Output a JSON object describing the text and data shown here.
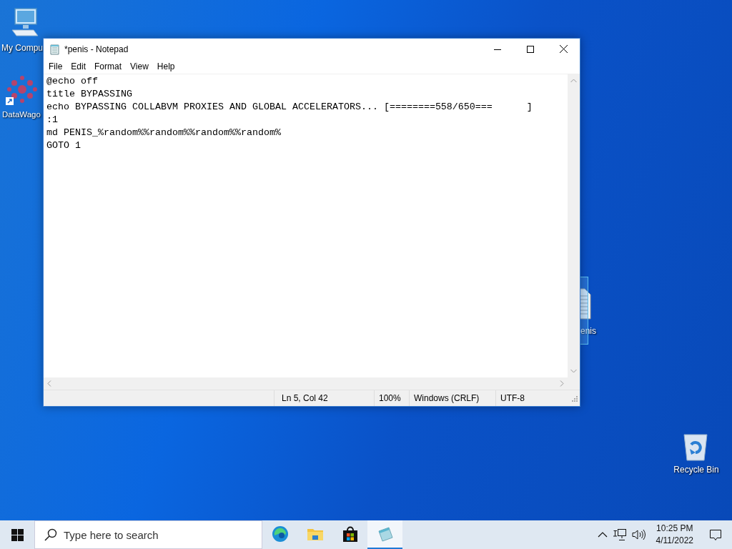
{
  "desktop": {
    "icons": [
      {
        "kind": "computer",
        "label": "My Compu",
        "selected": false
      },
      {
        "kind": "cluster",
        "label": "DataWago",
        "selected": false
      },
      {
        "kind": "document",
        "label": "enis",
        "selected": true
      },
      {
        "kind": "recycle",
        "label": "Recycle Bin",
        "selected": false
      }
    ]
  },
  "window": {
    "title": "*penis - Notepad",
    "menu": [
      "File",
      "Edit",
      "Format",
      "View",
      "Help"
    ],
    "lines": [
      "@echo off",
      "title BYPASSING",
      "echo BYPASSING COLLABVM PROXIES AND GLOBAL ACCELERATORS... [========558/650===      ]",
      ":1",
      "md PENIS_%random%%random%%random%%random%",
      "GOTO 1"
    ],
    "status_bar": [
      "Ln 5, Col 42",
      "100%",
      "Windows (CRLF)",
      "UTF-8"
    ]
  },
  "taskbar": {
    "search": {
      "placeholder": "Type here to search"
    },
    "apps": [
      {
        "kind": "edge",
        "selected": false
      },
      {
        "kind": "folder",
        "selected": false
      },
      {
        "kind": "store",
        "selected": false
      },
      {
        "kind": "notepad",
        "selected": true
      }
    ],
    "time": "10:25 PM",
    "date": "4/11/2022"
  }
}
